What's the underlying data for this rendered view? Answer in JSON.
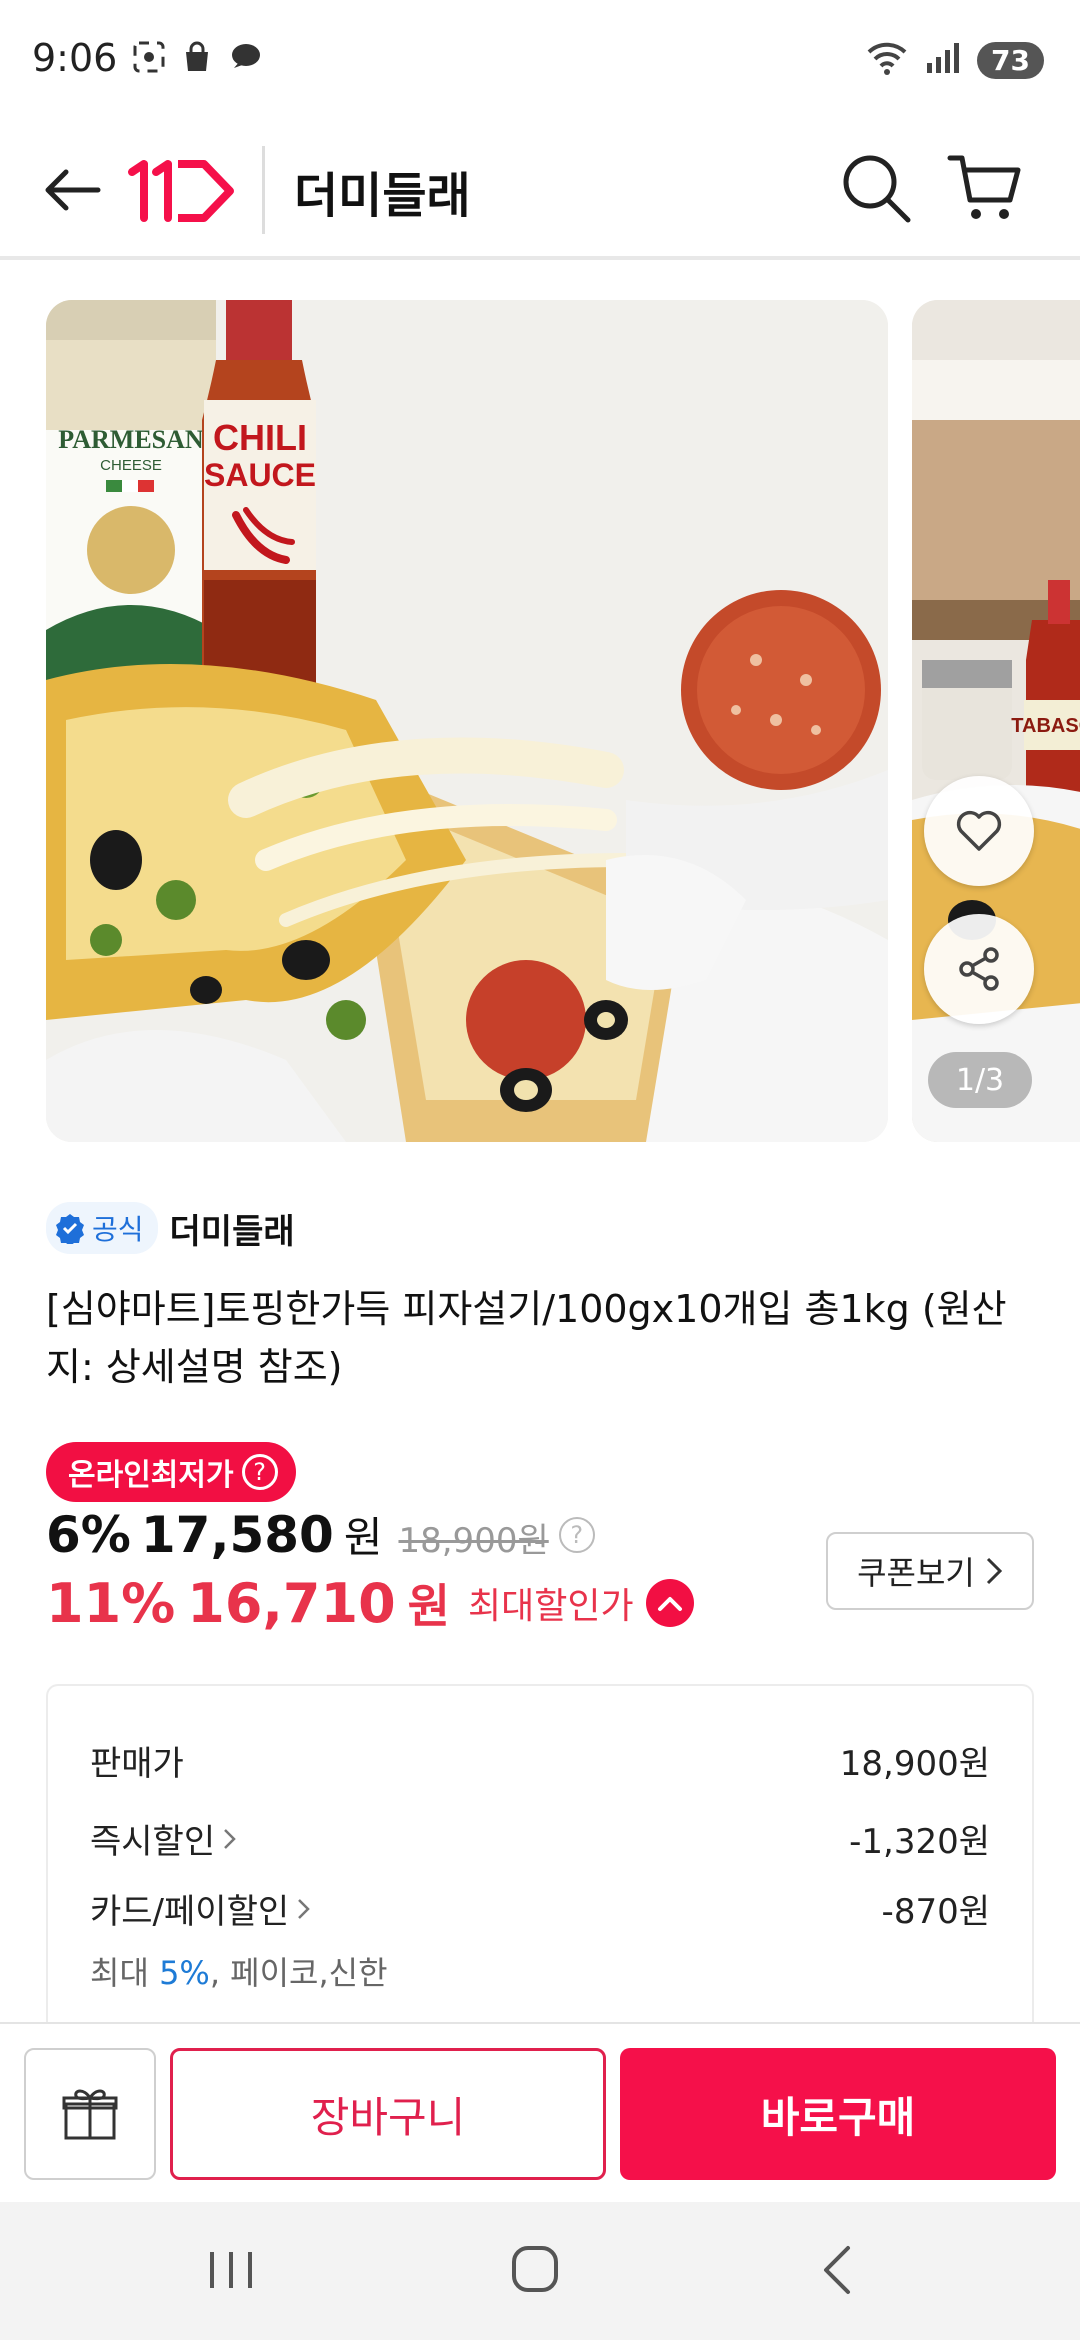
{
  "status_bar": {
    "time": "9:06",
    "battery": "73"
  },
  "header": {
    "logo_text": "11번가",
    "title": "더미들래"
  },
  "carousel": {
    "counter": "1/3",
    "main_image_labels": {
      "parmesan_line1": "PARMESAN",
      "parmesan_line2": "CHEESE",
      "chili_line1": "CHILI",
      "chili_line2": "SAUCE"
    },
    "next_image_label": "TABASCO"
  },
  "product": {
    "official_label": "공식",
    "seller": "더미들래",
    "title": "[심야마트]토핑한가득 피자설기/100gx10개입 총1kg (원산지: 상세설명 참조)",
    "promo_badge": "온라인최저가",
    "promo_badge_icon": "?",
    "price1": {
      "discount": "6%",
      "price": "17,580",
      "won": "원",
      "original": "18,900원"
    },
    "price2": {
      "discount": "11%",
      "price": "16,710",
      "won": "원",
      "label": "최대할인가"
    },
    "coupon_button": "쿠폰보기"
  },
  "price_breakdown": {
    "rows": [
      {
        "label": "판매가",
        "value": "18,900원"
      },
      {
        "label": "즉시할인",
        "value": "-1,320원"
      },
      {
        "label": "카드/페이할인",
        "value": "-870원"
      }
    ],
    "card_note_prefix": "최대 ",
    "card_note_highlight": "5%",
    "card_note_suffix": ", 페이코,신한"
  },
  "bottom_bar": {
    "cart_button": "장바구니",
    "buy_button": "바로구매"
  },
  "colors": {
    "brand_red": "#f5104a",
    "price_red": "#e8334b",
    "highlight_blue": "#1e7bd6"
  }
}
